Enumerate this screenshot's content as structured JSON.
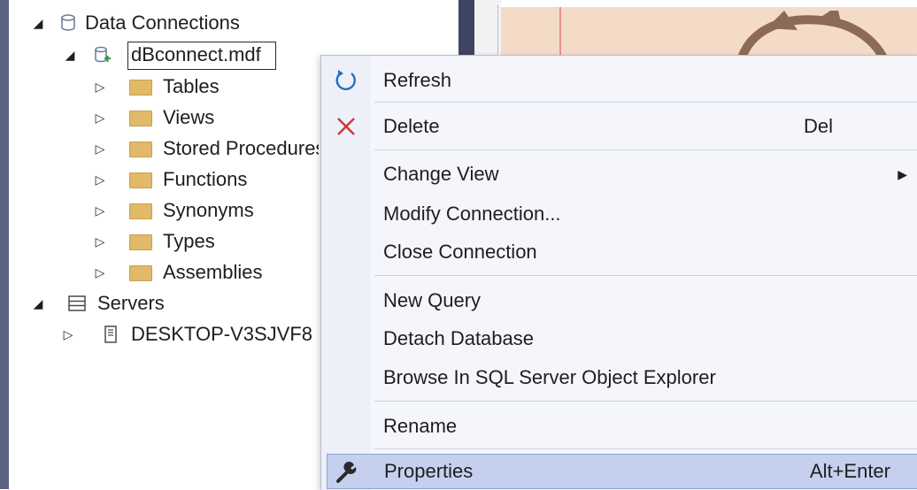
{
  "tree": {
    "data_connections": "Data Connections",
    "db_file": "dBconnect.mdf",
    "folders": [
      "Tables",
      "Views",
      "Stored Procedures",
      "Functions",
      "Synonyms",
      "Types",
      "Assemblies"
    ],
    "servers": "Servers",
    "server_node": "DESKTOP-V3SJVF8"
  },
  "menu": {
    "refresh": "Refresh",
    "delete": "Delete",
    "delete_key": "Del",
    "change_view": "Change View",
    "modify_connection": "Modify Connection...",
    "close_connection": "Close Connection",
    "new_query": "New Query",
    "detach_database": "Detach Database",
    "browse_sql": "Browse In SQL Server Object Explorer",
    "rename": "Rename",
    "properties": "Properties",
    "properties_key": "Alt+Enter"
  },
  "icons": {
    "refresh": "refresh-icon",
    "delete": "delete-x-icon",
    "properties": "wrench-icon"
  },
  "colors": {
    "delete_icon": "#d13438",
    "refresh_icon": "#1f6fc5",
    "selection": "#cfd8f0",
    "menu_hover": "#c4d0ee"
  }
}
